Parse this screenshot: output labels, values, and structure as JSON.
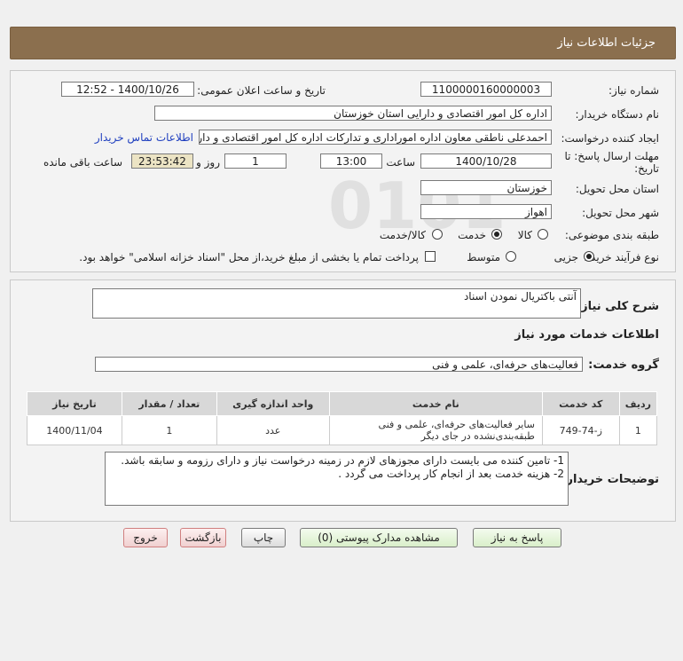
{
  "header": {
    "title": "جزئیات اطلاعات نیاز"
  },
  "form": {
    "need_number_label": "شماره نیاز:",
    "need_number": "1100000160000003",
    "announce_label": "تاریخ و ساعت اعلان عمومی:",
    "announce_value": "1400/10/26 - 12:52",
    "buyer_org_label": "نام دستگاه خریدار:",
    "buyer_org": "اداره کل امور اقتصادی و دارایی استان خوزستان",
    "creator_label": "ایجاد کننده درخواست:",
    "creator": "احمدعلی ناطقی معاون اداره اموراداری و تدارکات اداره کل امور اقتصادی و دارایی",
    "contact_link": "اطلاعات تماس خریدار",
    "deadline_label_1": "مهلت ارسال پاسخ: تا",
    "deadline_label_2": "تاریخ:",
    "deadline_date": "1400/10/28",
    "time_label": "ساعت",
    "deadline_time": "13:00",
    "days_value": "1",
    "days_label": "روز و",
    "remaining_time": "23:53:42",
    "remaining_label": "ساعت باقی مانده",
    "province_label": "استان محل تحویل:",
    "province": "خوزستان",
    "city_label": "شهر محل تحویل:",
    "city": "اهواز",
    "category_label": "طبقه بندی موضوعی:",
    "category_options": [
      "کالا",
      "خدمت",
      "کالا/خدمت"
    ],
    "category_selected": "خدمت",
    "purchase_type_label": "نوع فرآیند خرید :",
    "purchase_options": [
      "جزیی",
      "متوسط"
    ],
    "purchase_selected": "جزیی",
    "payment_note": "پرداخت تمام یا بخشی از مبلغ خرید،از محل \"اسناد خزانه اسلامی\" خواهد بود."
  },
  "need": {
    "summary_label": "شرح کلی نیاز:",
    "summary": "آنتی باکتریال نمودن اسناد",
    "services_heading": "اطلاعات خدمات مورد نیاز",
    "service_group_label": "گروه خدمت:",
    "service_group": "فعالیت‌های حرفه‌ای، علمی و فنی"
  },
  "table": {
    "headers": [
      "ردیف",
      "کد خدمت",
      "نام خدمت",
      "واحد اندازه گیری",
      "تعداد / مقدار",
      "تاریخ نیاز"
    ],
    "rows": [
      [
        "1",
        "ز-74-749",
        "سایر فعالیت‌های حرفه‌ای، علمی و فنی طبقه‌بندی‌نشده در جای دیگر",
        "عدد",
        "1",
        "1400/11/04"
      ]
    ]
  },
  "notes": {
    "label": "توضیحات خریدار:",
    "line1": "1- تامین کننده می بایست دارای مجوزهای لازم در زمینه درخواست نیاز و دارای رزومه و سابقه باشد.",
    "line2": "2- هزینه خدمت بعد از انجام کار پرداخت می گردد ."
  },
  "buttons": {
    "reply": "پاسخ به نیاز",
    "attachments": "مشاهده مدارک پیوستی (0)",
    "print": "چاپ",
    "back": "بازگشت",
    "exit": "خروج"
  },
  "colors": {
    "title_bar": "#8b6f4e",
    "link": "#1f3fbf",
    "exit_button_border": "#d08080",
    "reply_button_bg": "#e4f5d8"
  }
}
